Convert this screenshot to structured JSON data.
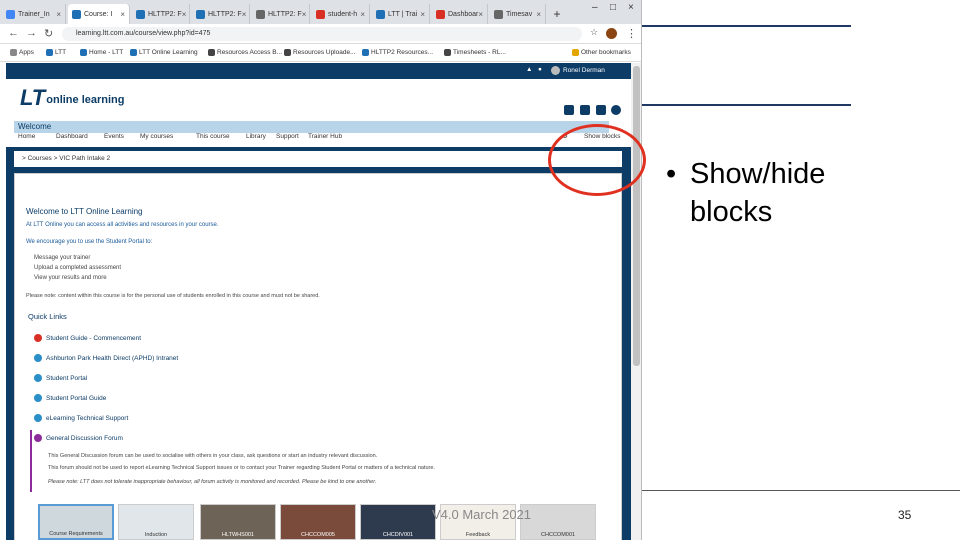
{
  "browser": {
    "tabs": [
      {
        "label": "Trainer_In",
        "color": "#4285f4"
      },
      {
        "label": "Course: I",
        "color": "#1f6fb5",
        "active": true
      },
      {
        "label": "HLTTP2: F",
        "color": "#1f6fb5"
      },
      {
        "label": "HLTTP2: F",
        "color": "#1f6fb5"
      },
      {
        "label": "HLTTP2: F",
        "color": "#666666"
      },
      {
        "label": "student-h",
        "color": "#d93025"
      },
      {
        "label": "LTT | Trai",
        "color": "#1f6fb5"
      },
      {
        "label": "Dashboar",
        "color": "#d93025"
      },
      {
        "label": "Timesav",
        "color": "#666666"
      }
    ],
    "new_tab": "+",
    "url": "learning.ltt.com.au/course/view.php?id=475",
    "bookmarks": [
      "Apps",
      "LTT",
      "Home - LTT",
      "LTT Online Learning",
      "Resources Access B...",
      "Resources Uploade...",
      "HLTTP2 Resources...",
      "Timesheets - RL...",
      "Other bookmarks"
    ]
  },
  "site": {
    "user": "Ronel Derman",
    "logo_mark": "LT",
    "logo_text": "online learning",
    "menu": [
      "Home",
      "Dashboard",
      "Events",
      "My courses",
      "This course",
      "Library",
      "Support",
      "Trainer Hub"
    ],
    "show_blocks": "Show blocks",
    "breadcrumb": "> Courses > VIC Path Intake 2",
    "welcome_header": "Welcome",
    "welcome_title": "Welcome to LTT Online Learning",
    "welcome_line1": "At LTT Online you can access all activities and resources in your course.",
    "welcome_line2": "We encourage you to use the Student Portal to:",
    "list": [
      "Message your trainer",
      "Upload a completed assessment",
      "View your results and more"
    ],
    "note": "Please note: content within this course is for the personal use of students enrolled in this course and must not be shared.",
    "quick_links_title": "Quick Links",
    "quick_links": [
      {
        "label": "Student Guide - Commencement",
        "color": "#d93025"
      },
      {
        "label": "Ashburton Park Health Direct (APHD) Intranet",
        "color": "#2a8fc9"
      },
      {
        "label": "Student Portal",
        "color": "#2a8fc9"
      },
      {
        "label": "Student Portal Guide",
        "color": "#2a8fc9"
      },
      {
        "label": "eLearning Technical Support",
        "color": "#2a8fc9"
      },
      {
        "label": "General Discussion Forum",
        "color": "#8b2c9a"
      }
    ],
    "forum_text1": "This General Discussion forum can be used to socialise with others in your class, ask questions or start an industry relevant discussion.",
    "forum_text2": "This forum should not be used to report eLearning Technical Support issues or to contact your Trainer regarding Student Portal or matters of a technical nature.",
    "forum_text3": "Please note: LTT does not tolerate inappropriate behaviour, all forum activity is monitored and recorded. Please be kind to one another.",
    "thumbs": [
      "Course Requirements",
      "Induction",
      "HLTWHS001",
      "CHCCOM005",
      "CHCDIV001",
      "Feedback",
      "CHCCOM001"
    ]
  },
  "slide": {
    "bullet": "Show/hide blocks",
    "bullet_symbol": "•",
    "footer_version": "V4.0 March 2021",
    "page_number": "35",
    "circle_color": "#e03020"
  }
}
